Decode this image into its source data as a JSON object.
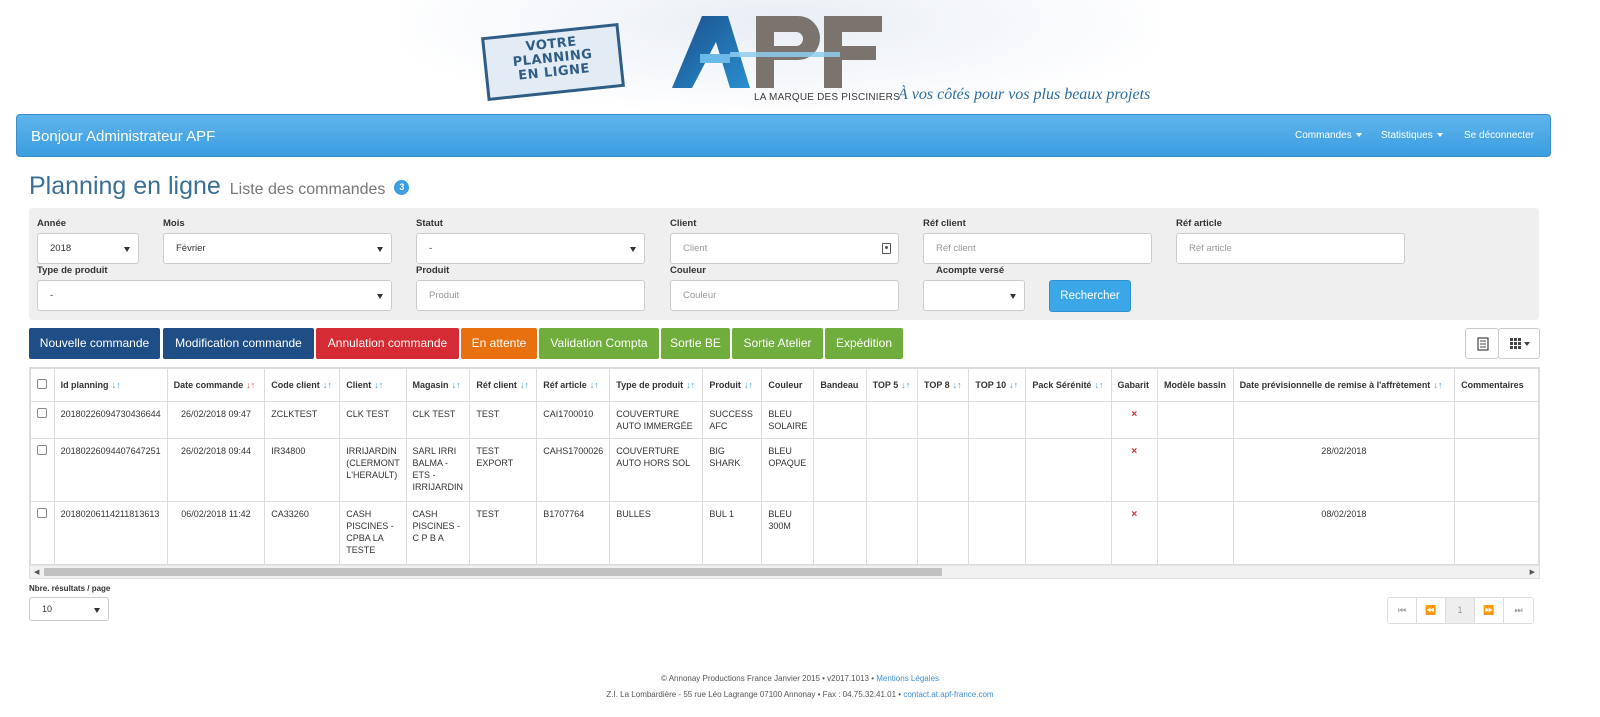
{
  "header": {
    "stamp_lines": [
      "VOTRE",
      "PLANNING",
      "EN LIGNE"
    ],
    "logo_text": "APF",
    "tagline": "LA MARQUE DES PISCINIERS",
    "slogan": "À vos côtés pour vos plus beaux projets"
  },
  "navbar": {
    "brand": "Bonjour Administrateur APF",
    "items": [
      "Commandes",
      "Statistiques",
      "Se déconnecter"
    ]
  },
  "page": {
    "title": "Planning en ligne",
    "subtitle": "Liste des commandes",
    "count": "3"
  },
  "filters": {
    "annee_label": "Année",
    "annee_value": "2018",
    "mois_label": "Mois",
    "mois_value": "Février",
    "statut_label": "Statut",
    "statut_value": "-",
    "client_label": "Client",
    "client_placeholder": "Client",
    "ref_client_label": "Réf client",
    "ref_client_placeholder": "Réf client",
    "ref_article_label": "Réf article",
    "ref_article_placeholder": "Réf article",
    "type_label": "Type de produit",
    "type_value": "-",
    "produit_label": "Produit",
    "produit_placeholder": "Produit",
    "couleur_label": "Couleur",
    "couleur_placeholder": "Couleur",
    "acompte_label": "Acompte versé",
    "acompte_value": "",
    "search_label": "Rechercher"
  },
  "actions": [
    {
      "label": "Nouvelle commande",
      "color": "#1f4e86"
    },
    {
      "label": "Modification commande",
      "color": "#1f4e86"
    },
    {
      "label": "Annulation commande",
      "color": "#d52b34"
    },
    {
      "label": "En attente",
      "color": "#e8700f"
    },
    {
      "label": "Validation Compta",
      "color": "#6fad3c"
    },
    {
      "label": "Sortie BE",
      "color": "#6fad3c"
    },
    {
      "label": "Sortie Atelier",
      "color": "#6fad3c"
    },
    {
      "label": "Expédition",
      "color": "#6fad3c"
    }
  ],
  "table": {
    "columns": [
      "Id planning",
      "Date commande",
      "Code client",
      "Client",
      "Magasin",
      "Réf client",
      "Réf article",
      "Type de produit",
      "Produit",
      "Couleur",
      "Bandeau",
      "TOP 5",
      "TOP 8",
      "TOP 10",
      "Pack Sérénité",
      "Gabarit",
      "Modèle bassin",
      "Date prévisionnelle de remise à l'affrètement",
      "Commentaires"
    ],
    "rows": [
      [
        "20180226094730436644",
        "26/02/2018 09:47",
        "ZCLKTEST",
        "CLK TEST",
        "CLK TEST",
        "TEST",
        "CAI1700010",
        "COUVERTURE AUTO IMMERGÉE",
        "SUCCESS AFC",
        "BLEU SOLAIRE",
        "",
        "",
        "",
        "",
        "",
        "×",
        "",
        "",
        ""
      ],
      [
        "20180226094407647251",
        "26/02/2018 09:44",
        "IR34800",
        "IRRIJARDIN (CLERMONT L'HERAULT)",
        "SARL IRRI BALMA - ETS - IRRIJARDIN",
        "TEST EXPORT",
        "CAHS1700026",
        "COUVERTURE AUTO HORS SOL",
        "BIG SHARK",
        "BLEU OPAQUE",
        "",
        "",
        "",
        "",
        "",
        "×",
        "",
        "28/02/2018",
        ""
      ],
      [
        "20180206114211813613",
        "06/02/2018 11:42",
        "CA33260",
        "CASH PISCINES - CPBA LA TESTE",
        "CASH PISCINES - C P B A",
        "TEST",
        "B1707764",
        "BULLES",
        "BUL 1",
        "BLEU 300M",
        "",
        "",
        "",
        "",
        "",
        "×",
        "",
        "08/02/2018",
        ""
      ]
    ]
  },
  "pagination": {
    "per_page_label": "Nbre. résultats / page",
    "per_page_value": "10",
    "current_page": "1"
  },
  "footer": {
    "line1_text": "© Annonay Productions France Janvier 2015 • v2017.1013 •",
    "line1_link": "Mentions Légales",
    "line2_text": "Z.I. La Lombardière - 55 rue Léo Lagrange 07100 Annonay • Fax : 04.75.32.41.01 •",
    "line2_link": "contact.at.apf-france.com"
  },
  "colors": {
    "navbar": "#3b9ee0",
    "title": "#3a6f96",
    "search_button": "#3ba7e8"
  }
}
